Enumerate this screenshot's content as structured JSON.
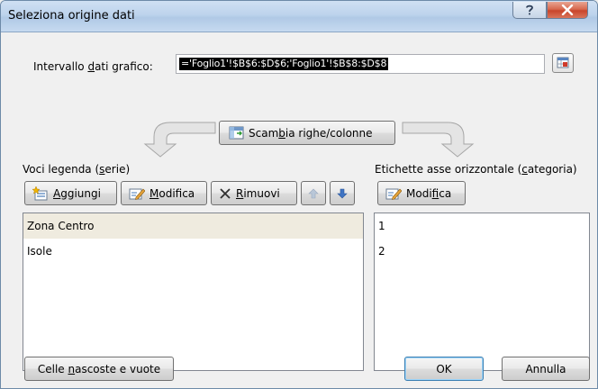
{
  "window": {
    "title": "Seleziona origine dati"
  },
  "range": {
    "label_pre": "Intervallo ",
    "label_u": "d",
    "label_post": "ati grafico:",
    "value": "='Foglio1'!$B$6:$D$6;'Foglio1'!$B$8:$D$8"
  },
  "swap_button": {
    "pre": "Scam",
    "u": "b",
    "post": "ia righe/colonne"
  },
  "legend": {
    "label_pre": "Voci legenda (",
    "label_u": "s",
    "label_post": "erie)",
    "add": {
      "u": "A",
      "post": "ggiungi"
    },
    "edit": {
      "u": "M",
      "post": "odifica"
    },
    "remove": {
      "u": "R",
      "post": "imuovi"
    },
    "items": [
      "Zona Centro",
      "Isole"
    ]
  },
  "axis": {
    "label_pre": "Etichette asse orizzontale (",
    "label_u": "c",
    "label_post": "ategoria)",
    "edit": {
      "pre": "Modi",
      "u": "f",
      "post": "ica"
    },
    "items": [
      "1",
      "2"
    ]
  },
  "hidden_cells": {
    "pre": "Celle ",
    "u": "n",
    "post": "ascoste e vuote"
  },
  "ok_label": "OK",
  "cancel_label": "Annulla",
  "icons": {
    "help": "question-mark-icon",
    "close": "close-x-icon"
  },
  "colors": {
    "title_bar": "#bdd3ec",
    "close_button": "#c9452b",
    "selected_row": "#efebdf"
  }
}
